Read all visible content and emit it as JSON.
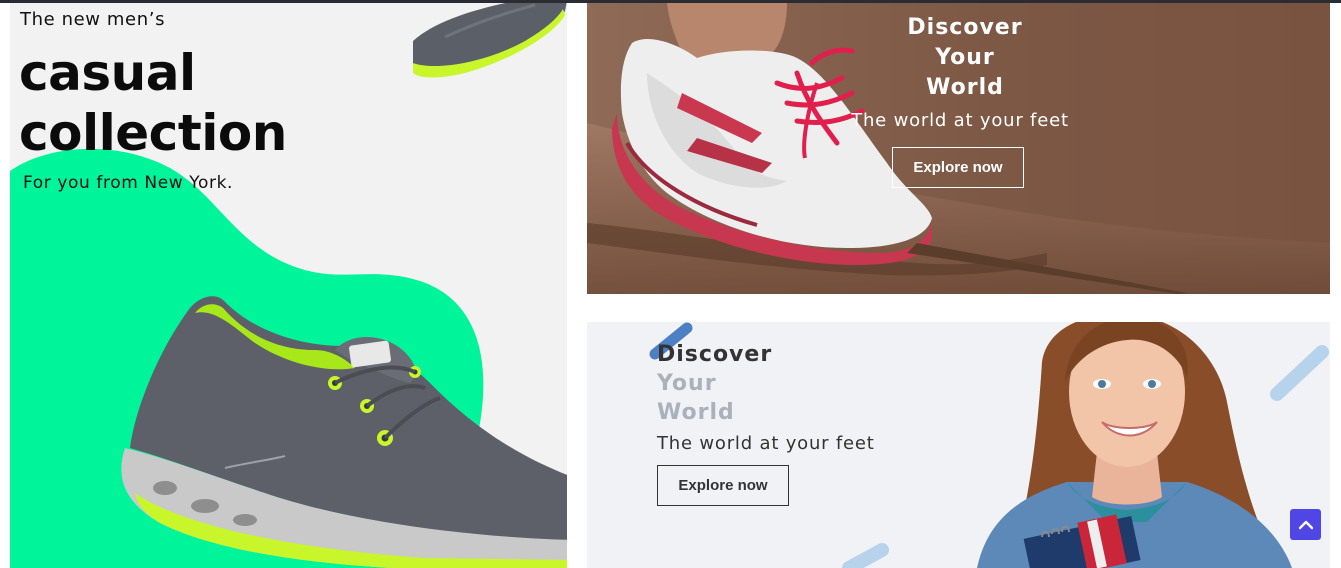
{
  "colors": {
    "accent_green": "#00f59b",
    "brown_banner": "#7a5240",
    "scroll_button": "#4f46e5"
  },
  "left_banner": {
    "kicker": "The new men’s",
    "title_line1": "casual",
    "title_line2": "collection",
    "subtitle": "For you from New York."
  },
  "top_right_banner": {
    "heading_line1": "Discover",
    "heading_line2": "Your",
    "heading_line3": "World",
    "tagline": "The world at your feet",
    "button_label": "Explore now"
  },
  "bottom_right_banner": {
    "heading_line1": "Discover",
    "heading_line2": "Your",
    "heading_line3": "World",
    "tagline": "The world at your feet",
    "button_label": "Explore now"
  },
  "scroll_top": {
    "icon": "chevron-up-icon"
  }
}
